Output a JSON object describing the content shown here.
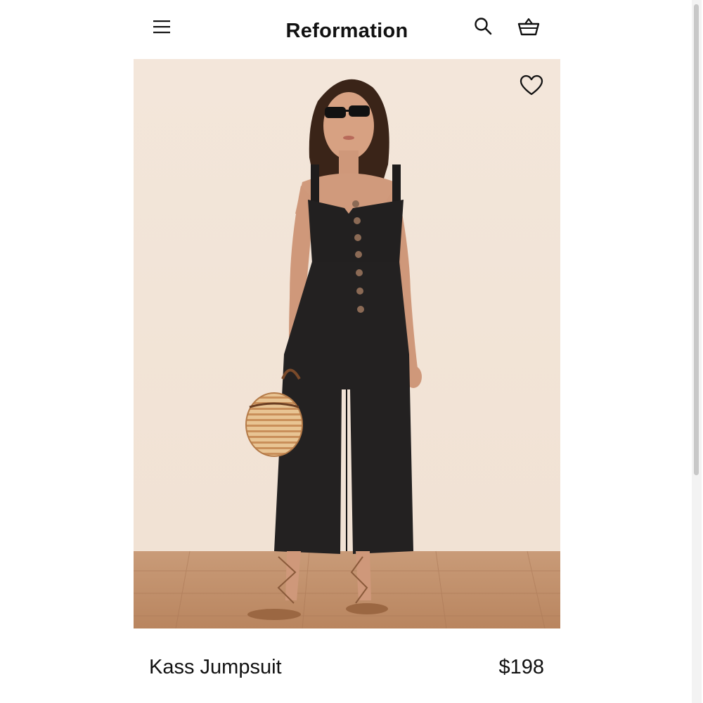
{
  "header": {
    "brand": "Reformation",
    "menu_icon": "hamburger-menu-icon",
    "search_icon": "search-icon",
    "cart_icon": "shopping-basket-icon"
  },
  "product": {
    "name": "Kass Jumpsuit",
    "price": "$198",
    "wishlist_icon": "heart-outline-icon",
    "image_alt": "Model wearing a black button-front wide-leg jumpsuit holding a woven straw bag"
  },
  "colors": {
    "background": "#ffffff",
    "image_backdrop": "#f2e4d8",
    "text": "#111111"
  }
}
